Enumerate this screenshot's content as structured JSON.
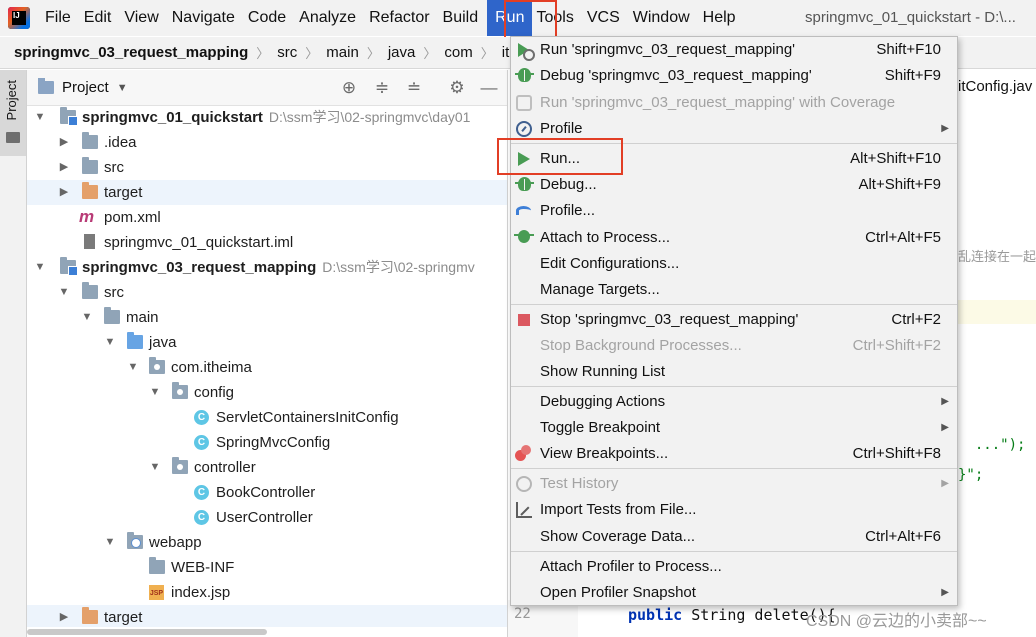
{
  "menubar": {
    "items": [
      {
        "label": "File"
      },
      {
        "label": "Edit"
      },
      {
        "label": "View"
      },
      {
        "label": "Navigate"
      },
      {
        "label": "Code"
      },
      {
        "label": "Analyze"
      },
      {
        "label": "Refactor"
      },
      {
        "label": "Build"
      },
      {
        "label": "Run"
      },
      {
        "label": "Tools"
      },
      {
        "label": "VCS"
      },
      {
        "label": "Window"
      },
      {
        "label": "Help"
      }
    ],
    "active": "Run",
    "window_title": "springmvc_01_quickstart - D:\\...",
    "highlight_color": "#e23e25",
    "active_color": "#2f65ca"
  },
  "breadcrumb": [
    "springmvc_03_request_mapping",
    "src",
    "main",
    "java",
    "com",
    "ithei"
  ],
  "tool_stripe": {
    "project_label": "Project"
  },
  "project_panel": {
    "title": "Project",
    "header_buttons": [
      "locate-icon",
      "expand-all-icon",
      "collapse-all-icon",
      "settings-icon",
      "minimize-icon"
    ],
    "tree": [
      {
        "label": "springmvc_01_quickstart",
        "path": "D:\\ssm学习\\02-springmvc\\day01",
        "bold": true,
        "expanded": true,
        "icon": "module-folder-icon"
      },
      {
        "label": ".idea",
        "expanded": false,
        "icon": "folder-icon"
      },
      {
        "label": "src",
        "expanded": false,
        "icon": "folder-icon"
      },
      {
        "label": "target",
        "expanded": false,
        "icon": "excluded-folder-icon",
        "highlighted": true
      },
      {
        "label": "pom.xml",
        "icon": "maven-icon"
      },
      {
        "label": "springmvc_01_quickstart.iml",
        "icon": "iml-file-icon"
      },
      {
        "label": "springmvc_03_request_mapping",
        "path": "D:\\ssm学习\\02-springmv",
        "bold": true,
        "expanded": true,
        "icon": "module-folder-icon"
      },
      {
        "label": "src",
        "expanded": true,
        "icon": "folder-icon"
      },
      {
        "label": "main",
        "expanded": true,
        "icon": "folder-icon"
      },
      {
        "label": "java",
        "expanded": true,
        "icon": "source-folder-icon"
      },
      {
        "label": "com.itheima",
        "expanded": true,
        "icon": "package-icon"
      },
      {
        "label": "config",
        "expanded": true,
        "icon": "package-icon"
      },
      {
        "label": "ServletContainersInitConfig",
        "icon": "class-icon"
      },
      {
        "label": "SpringMvcConfig",
        "icon": "class-icon"
      },
      {
        "label": "controller",
        "expanded": true,
        "icon": "package-icon"
      },
      {
        "label": "BookController",
        "icon": "class-icon"
      },
      {
        "label": "UserController",
        "icon": "class-icon"
      },
      {
        "label": "webapp",
        "expanded": true,
        "icon": "web-folder-icon"
      },
      {
        "label": "WEB-INF",
        "icon": "folder-icon"
      },
      {
        "label": "index.jsp",
        "icon": "jsp-file-icon"
      },
      {
        "label": "target",
        "expanded": false,
        "icon": "excluded-folder-icon",
        "highlighted": true
      }
    ]
  },
  "editor": {
    "tab_fragment": "itConfig.jav",
    "comment_fragment": "乱连接在一起",
    "code_fragment_1_plain": "  ",
    "code_fragment_1_string": "...\");",
    "code_fragment_2": "}\";",
    "line_number": "22",
    "line_22_keyword": "public",
    "line_22_rest": " String delete(){",
    "watermark": "CSDN @云边的小卖部~~"
  },
  "run_menu": {
    "items": [
      {
        "label": "Run 'springmvc_03_request_mapping'",
        "shortcut": "Shift+F10",
        "icon": "run-config-icon",
        "disabled": false
      },
      {
        "label": "Debug 'springmvc_03_request_mapping'",
        "shortcut": "Shift+F9",
        "icon": "debug-icon",
        "disabled": false
      },
      {
        "label": "Run 'springmvc_03_request_mapping' with Coverage",
        "shortcut": "",
        "icon": "coverage-icon",
        "disabled": true
      },
      {
        "label": "Profile",
        "shortcut": "",
        "icon": "profile-icon",
        "submenu": true,
        "disabled": false
      },
      {
        "label": "Run...",
        "shortcut": "Alt+Shift+F10",
        "icon": "run-icon",
        "disabled": false,
        "highlighted": true
      },
      {
        "label": "Debug...",
        "shortcut": "Alt+Shift+F9",
        "icon": "debug-icon",
        "disabled": false
      },
      {
        "label": "Profile...",
        "shortcut": "",
        "icon": "profiler-gauge-icon",
        "disabled": false
      },
      {
        "label": "Attach to Process...",
        "shortcut": "Ctrl+Alt+F5",
        "icon": "attach-debugger-icon",
        "disabled": false
      },
      {
        "label": "Edit Configurations...",
        "shortcut": "",
        "icon": "",
        "disabled": false
      },
      {
        "label": "Manage Targets...",
        "shortcut": "",
        "icon": "",
        "disabled": false
      },
      {
        "label": "Stop 'springmvc_03_request_mapping'",
        "shortcut": "Ctrl+F2",
        "icon": "stop-icon",
        "disabled": false
      },
      {
        "label": "Stop Background Processes...",
        "shortcut": "Ctrl+Shift+F2",
        "icon": "",
        "disabled": true
      },
      {
        "label": "Show Running List",
        "shortcut": "",
        "icon": "",
        "disabled": false
      },
      {
        "label": "Debugging Actions",
        "shortcut": "",
        "icon": "",
        "submenu": true,
        "disabled": false
      },
      {
        "label": "Toggle Breakpoint",
        "shortcut": "",
        "icon": "",
        "submenu": true,
        "disabled": false
      },
      {
        "label": "View Breakpoints...",
        "shortcut": "Ctrl+Shift+F8",
        "icon": "breakpoints-icon",
        "disabled": false
      },
      {
        "label": "Test History",
        "shortcut": "",
        "icon": "history-icon",
        "submenu": true,
        "disabled": true
      },
      {
        "label": "Import Tests from File...",
        "shortcut": "",
        "icon": "import-icon",
        "disabled": false
      },
      {
        "label": "Show Coverage Data...",
        "shortcut": "Ctrl+Alt+F6",
        "icon": "",
        "disabled": false
      },
      {
        "label": "Attach Profiler to Process...",
        "shortcut": "",
        "icon": "",
        "disabled": false
      },
      {
        "label": "Open Profiler Snapshot",
        "shortcut": "",
        "icon": "",
        "submenu": true,
        "disabled": false
      }
    ]
  }
}
